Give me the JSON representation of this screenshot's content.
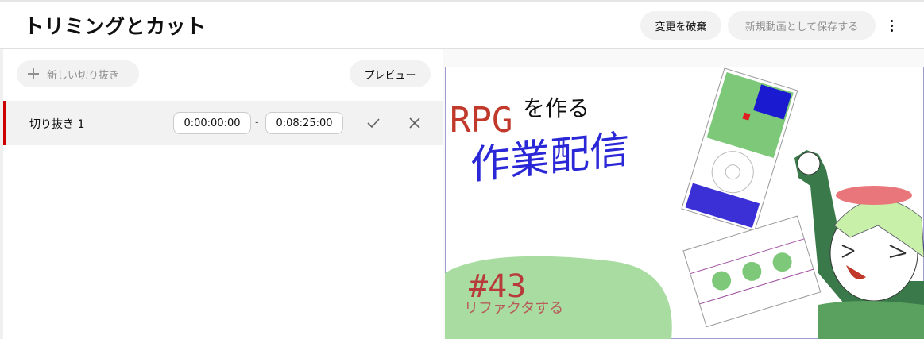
{
  "header": {
    "title": "トリミングとカット",
    "discard_label": "変更を破棄",
    "save_label": "新規動画として保存する"
  },
  "toolbar": {
    "new_clip_label": "新しい切り抜き",
    "preview_label": "プレビュー"
  },
  "clips": [
    {
      "label": "切り抜き 1",
      "start": "0:00:00:00",
      "end": "0:08:25:00"
    }
  ],
  "time_separator": "-",
  "thumbnail": {
    "title_line1": "RPG",
    "title_line1_suffix": "を作る",
    "title_line2": "作業配信",
    "episode": "#43",
    "subtitle": "リファクタする"
  },
  "colors": {
    "accent_red": "#cc0000",
    "thumb_red": "#c0392b",
    "thumb_blue": "#2a27d6",
    "thumb_green_blob": "#a8dca0"
  }
}
